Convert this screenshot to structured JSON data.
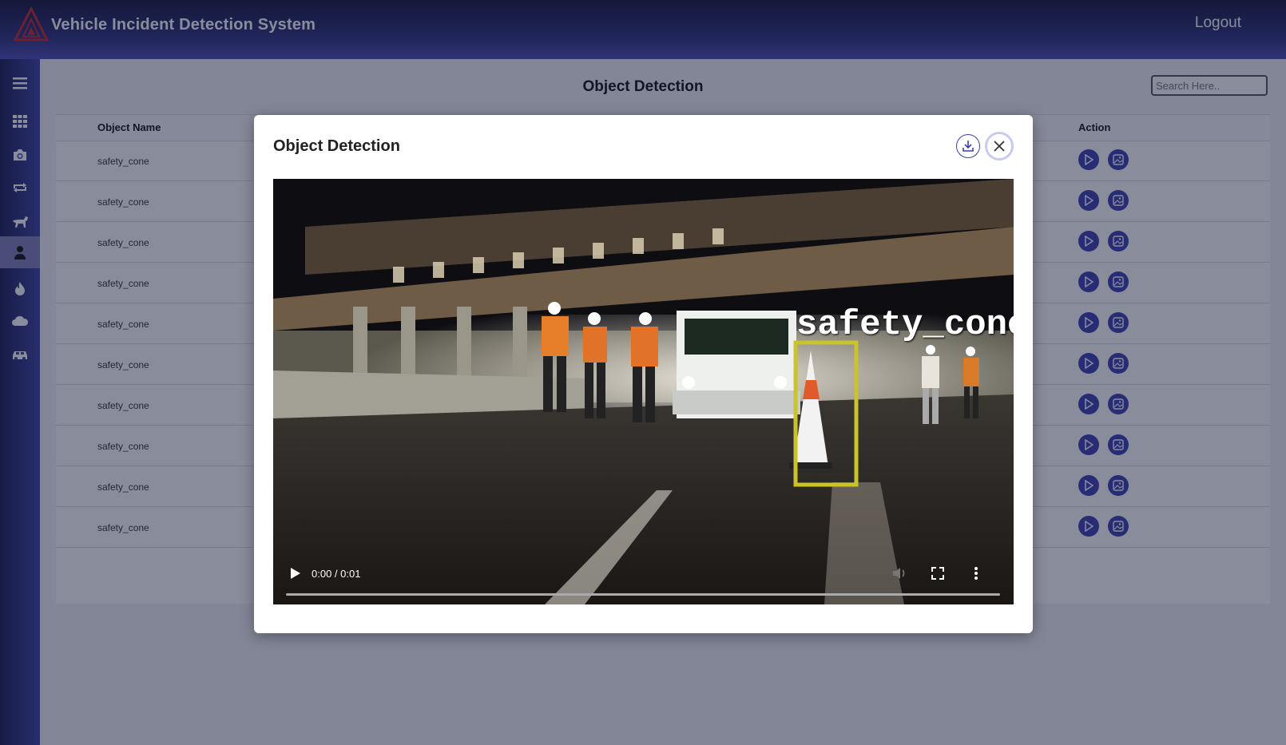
{
  "header": {
    "app_title": "Vehicle Incident Detection System",
    "logout_label": "Logout"
  },
  "sidebar": {
    "items": [
      {
        "icon": "menu-icon"
      },
      {
        "icon": "grid-icon"
      },
      {
        "icon": "camera-icon"
      },
      {
        "icon": "repeat-icon"
      },
      {
        "icon": "animal-icon"
      },
      {
        "icon": "person-icon",
        "active": true
      },
      {
        "icon": "fire-icon"
      },
      {
        "icon": "cloud-icon"
      },
      {
        "icon": "car-icon"
      }
    ]
  },
  "main": {
    "page_title": "Object Detection",
    "search": {
      "placeholder": "Search Here.."
    },
    "table": {
      "columns": [
        "Object Name",
        "Action"
      ],
      "rows": [
        {
          "object_name": "safety_cone"
        },
        {
          "object_name": "safety_cone"
        },
        {
          "object_name": "safety_cone"
        },
        {
          "object_name": "safety_cone"
        },
        {
          "object_name": "safety_cone"
        },
        {
          "object_name": "safety_cone"
        },
        {
          "object_name": "safety_cone"
        },
        {
          "object_name": "safety_cone"
        },
        {
          "object_name": "safety_cone"
        },
        {
          "object_name": "safety_cone"
        }
      ]
    }
  },
  "modal": {
    "title": "Object Detection",
    "video": {
      "detection_label": "safety_cone",
      "time": "0:00 / 0:01",
      "progress": 0
    }
  },
  "colors": {
    "accent": "#3c3fb0",
    "header": "#2c2f7a",
    "box": "#c9c42c"
  }
}
